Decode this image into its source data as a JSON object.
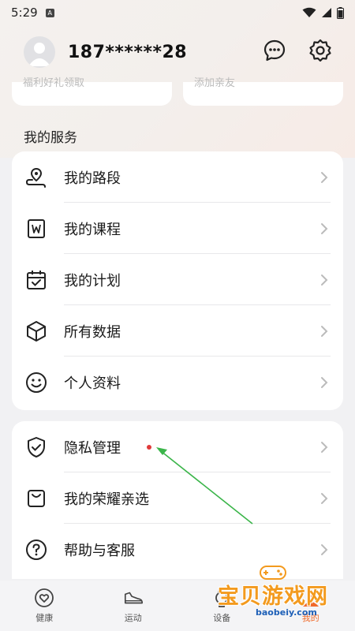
{
  "status_bar": {
    "time": "5:29",
    "notification_icon": "A"
  },
  "profile": {
    "phone": "187******28"
  },
  "cards_peek": {
    "left_text": "福利好礼领取",
    "right_text": "添加亲友"
  },
  "services": {
    "title": "我的服务",
    "items": [
      {
        "label": "我的路段",
        "icon": "route-icon"
      },
      {
        "label": "我的课程",
        "icon": "course-icon"
      },
      {
        "label": "我的计划",
        "icon": "calendar-icon"
      },
      {
        "label": "所有数据",
        "icon": "cube-icon"
      },
      {
        "label": "个人资料",
        "icon": "smile-icon"
      }
    ]
  },
  "more": {
    "items": [
      {
        "label": "隐私管理",
        "icon": "shield-icon",
        "badge": "red-dot"
      },
      {
        "label": "我的荣耀亲选",
        "icon": "bag-icon"
      },
      {
        "label": "帮助与客服",
        "icon": "help-icon"
      }
    ]
  },
  "nav": {
    "items": [
      {
        "label": "健康",
        "icon": "heart-icon"
      },
      {
        "label": "运动",
        "icon": "shoe-icon"
      },
      {
        "label": "设备",
        "icon": "watch-icon"
      },
      {
        "label": "我的",
        "icon": "user-icon"
      }
    ]
  },
  "watermark": {
    "text": "宝贝游戏网",
    "url": "baobeiy.com"
  },
  "colors": {
    "accent": "#f06a2a",
    "arrow": "#3bb54a",
    "badge": "#e03a3a"
  }
}
